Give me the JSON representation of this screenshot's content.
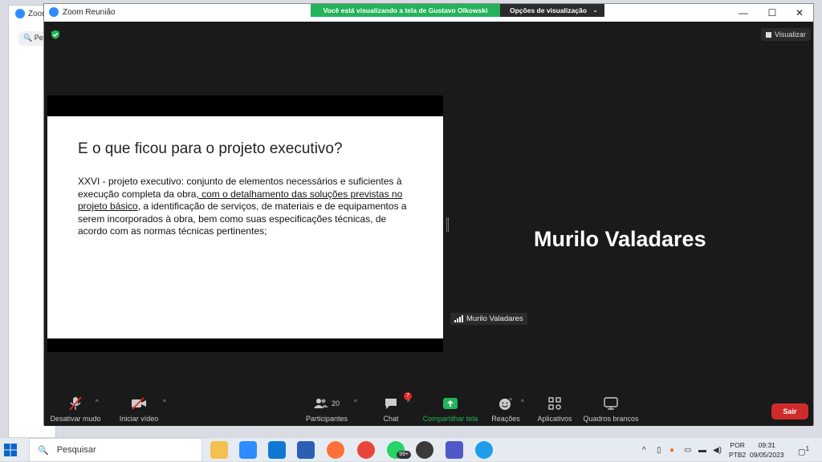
{
  "background_window": {
    "title": "Zoom",
    "search_text": "Pe"
  },
  "window": {
    "title": "Zoom Reunião",
    "minimize": "—",
    "maximize": "☐",
    "close": "✕"
  },
  "share_banner": {
    "text": "Você está visualizando a tela de Gustavo Olkowski"
  },
  "view_options": {
    "label": "Opções de visualização"
  },
  "visualizar": {
    "label": "Visualizar"
  },
  "slide": {
    "title": "E o que ficou para o projeto executivo?",
    "body_part1": "XXVI - projeto executivo: conjunto de elementos necessários e suficientes à execução completa da obra",
    "body_underlined": ", com o detalhamento das soluções previstas no projeto básico",
    "body_part2": ", a identificação de serviços, de materiais e de equipamentos a serem incorporados à obra, bem como suas especificações técnicas, de acordo com as normas técnicas pertinentes;"
  },
  "speaker": {
    "name": "Murilo Valadares",
    "tag": "Murilo Valadares"
  },
  "toolbar": {
    "mute": "Desativar mudo",
    "video": "Iniciar vídeo",
    "participants": "Participantes",
    "participants_count": "20",
    "chat": "Chat",
    "chat_badge": "7",
    "share": "Compartilhar tela",
    "reactions": "Reações",
    "apps": "Aplicativos",
    "whiteboards": "Quadros brancos",
    "leave": "Sair"
  },
  "taskbar": {
    "search_placeholder": "Pesquisar",
    "whatsapp_badge": "99+",
    "lang_top": "POR",
    "lang_bottom": "PTB2",
    "time": "09:31",
    "date": "09/05/2023",
    "notification_count": "1"
  },
  "colors": {
    "share_green": "#23b35a",
    "leave_red": "#d02b2b",
    "zoom_blue": "#2d8cff"
  }
}
